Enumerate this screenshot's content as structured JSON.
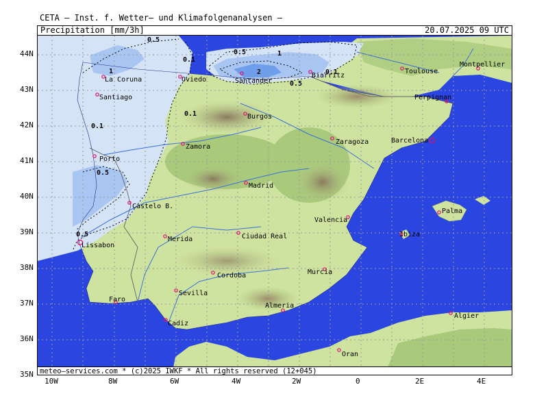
{
  "header": {
    "title": "CETA – Inst. f. Wetter– und Klimafolgenanalysen –",
    "parameter": "Precipitation [mm/3h]",
    "valid_time": "20.07.2025 09 UTC"
  },
  "footer": {
    "credit": "meteo–services.com * (c)2025 IWKF * All rights reserved (12+045)"
  },
  "axes": {
    "lat_labels": [
      "44N",
      "43N",
      "42N",
      "41N",
      "40N",
      "39N",
      "38N",
      "37N",
      "36N",
      "35N"
    ],
    "lon_labels": [
      "10W",
      "8W",
      "6W",
      "4W",
      "2W",
      "0",
      "2E",
      "4E"
    ]
  },
  "cities": [
    {
      "name": "La Coruna"
    },
    {
      "name": "Oviedo"
    },
    {
      "name": "Santander"
    },
    {
      "name": "Biarritz"
    },
    {
      "name": "Toulouse"
    },
    {
      "name": "Montpellier"
    },
    {
      "name": "Santiago"
    },
    {
      "name": "Perpignan"
    },
    {
      "name": "Burgos"
    },
    {
      "name": "Zaragoza"
    },
    {
      "name": "Barcelona"
    },
    {
      "name": "Zamora"
    },
    {
      "name": "Porto"
    },
    {
      "name": "Madrid"
    },
    {
      "name": "Castelo B."
    },
    {
      "name": "Palma"
    },
    {
      "name": "Valencia"
    },
    {
      "name": "Ibiza"
    },
    {
      "name": "Merida"
    },
    {
      "name": "Ciudad Real"
    },
    {
      "name": "Lissabon"
    },
    {
      "name": "Cordoba"
    },
    {
      "name": "Murcia"
    },
    {
      "name": "Sevilla"
    },
    {
      "name": "Faro"
    },
    {
      "name": "Almeria"
    },
    {
      "name": "Cadiz"
    },
    {
      "name": "Algier"
    },
    {
      "name": "Oran"
    }
  ],
  "isolines": [
    "0.5",
    "0.1",
    "0.5",
    "1",
    "0.1",
    "1",
    "2",
    "0.1",
    "0.5",
    "0.1",
    "0.1",
    "0.5",
    "0.5"
  ],
  "colors": {
    "sea": "#2b45e0",
    "precip_light": "#d5e3f7",
    "precip_mid": "#a9c6f2",
    "precip_high": "#6f9fea",
    "land_low": "#cfe3a0",
    "land_mid": "#a9c97b",
    "land_high": "#b59a74",
    "city_marker": "#e0106e"
  }
}
